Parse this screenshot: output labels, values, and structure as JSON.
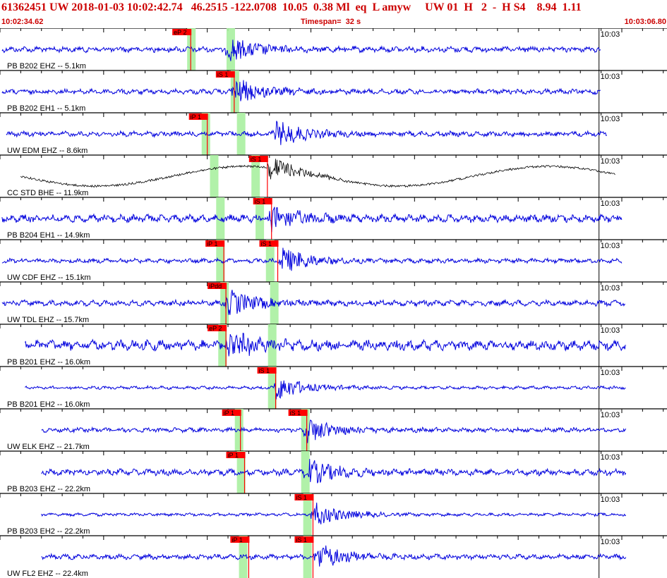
{
  "header": {
    "title": "61362451 UW 2018-01-03 10:02:42.74   46.2515 -122.0708  10.05  0.38 Ml  eq  L amyw     UW 01  H   2  -  H S4    8.94  1.11",
    "start_time": "10:02:34.62",
    "timespan": "Timespan=  32 s",
    "end_time": "10:03:06.80"
  },
  "colors": {
    "trace": "#0000dd",
    "trace_alt": "#000000",
    "pick_box": "#ff0000",
    "pick_line": "#ff0000",
    "window": "#a8f0a0",
    "header_text": "#cc0000"
  },
  "minute_label": "10:03",
  "time_axis": {
    "start_s": 0,
    "end_s": 32.18,
    "minute_mark_s": 28.9
  },
  "traces": [
    {
      "label": "PB B202 EHZ -- 5.1km",
      "color": "trace",
      "amp": 0.9,
      "start_s": 0.1,
      "end_s": 29.0,
      "burst_s": 11.0,
      "picks": [
        {
          "text": "eP 2",
          "t_s": 9.2
        }
      ],
      "windows_s": [
        9.2,
        11.1
      ]
    },
    {
      "label": "PB B202 EH1 -- 5.1km",
      "color": "trace",
      "amp": 0.8,
      "start_s": 0.1,
      "end_s": 29.0,
      "burst_s": 11.3,
      "picks": [
        {
          "text": "iS 1",
          "t_s": 11.3
        }
      ],
      "windows_s": [
        11.3
      ]
    },
    {
      "label": "UW EDM EHZ -- 8.6km",
      "color": "trace",
      "amp": 0.8,
      "start_s": 0.3,
      "end_s": 29.3,
      "burst_s": 13.3,
      "picks": [
        {
          "text": "iP 1",
          "t_s": 10.0
        }
      ],
      "windows_s": [
        9.9,
        11.6
      ]
    },
    {
      "label": "CC STD BHE -- 11.9km",
      "color": "trace_alt",
      "amp": 1.4,
      "start_s": 1.0,
      "end_s": 29.7,
      "burst_s": 12.9,
      "picks": [
        {
          "text": "iS 1",
          "t_s": 12.9
        }
      ],
      "windows_s": [
        10.3,
        12.3
      ]
    },
    {
      "label": "PB B204 EH1 -- 14.9km",
      "color": "trace",
      "amp": 1.2,
      "start_s": 0.1,
      "end_s": 30.0,
      "burst_s": 13.1,
      "picks": [
        {
          "text": "iS 1",
          "t_s": 13.1
        }
      ],
      "windows_s": [
        10.6,
        12.5
      ]
    },
    {
      "label": "UW CDF EHZ -- 15.1km",
      "color": "trace",
      "amp": 0.7,
      "start_s": 0.1,
      "end_s": 30.0,
      "burst_s": 13.6,
      "picks": [
        {
          "text": "iP 1",
          "t_s": 10.8
        },
        {
          "text": "iS 1",
          "t_s": 13.4
        }
      ],
      "windows_s": [
        10.6,
        13.0
      ]
    },
    {
      "label": "UW TDL EHZ -- 15.7km",
      "color": "trace",
      "amp": 0.9,
      "start_s": 0.1,
      "end_s": 30.2,
      "burst_s": 11.0,
      "picks": [
        {
          "text": "iPdd",
          "t_s": 10.9
        }
      ],
      "windows_s": [
        10.8,
        13.2
      ]
    },
    {
      "label": "PB B201 EHZ -- 16.0km",
      "color": "trace",
      "amp": 1.6,
      "start_s": 1.2,
      "end_s": 30.2,
      "burst_s": 11.0,
      "picks": [
        {
          "text": "eP 2",
          "t_s": 10.9
        }
      ],
      "windows_s": [
        10.7,
        13.1
      ]
    },
    {
      "label": "PB B201 EH2 -- 16.0km",
      "color": "trace",
      "amp": 0.5,
      "start_s": 1.2,
      "end_s": 30.2,
      "burst_s": 13.3,
      "picks": [
        {
          "text": "iS 1",
          "t_s": 13.3
        }
      ],
      "windows_s": [
        13.1
      ]
    },
    {
      "label": "UW ELK EHZ -- 21.7km",
      "color": "trace",
      "amp": 0.7,
      "start_s": 2.0,
      "end_s": 30.2,
      "burst_s": 14.8,
      "picks": [
        {
          "text": "iP 1",
          "t_s": 11.6
        },
        {
          "text": "iS 1",
          "t_s": 14.8
        }
      ],
      "windows_s": [
        11.5,
        14.7
      ]
    },
    {
      "label": "PB B203 EHZ -- 22.2km",
      "color": "trace",
      "amp": 1.0,
      "start_s": 2.0,
      "end_s": 30.2,
      "burst_s": 14.8,
      "picks": [
        {
          "text": "iP 1",
          "t_s": 11.8
        }
      ],
      "windows_s": [
        11.6,
        14.7
      ]
    },
    {
      "label": "PB B203 EH2 -- 22.2km",
      "color": "trace",
      "amp": 0.5,
      "start_s": 2.0,
      "end_s": 30.2,
      "burst_s": 15.1,
      "picks": [
        {
          "text": "iS 1",
          "t_s": 15.1
        }
      ],
      "windows_s": [
        14.8
      ]
    },
    {
      "label": "UW FL2 EHZ -- 22.4km",
      "color": "trace",
      "amp": 0.8,
      "start_s": 2.0,
      "end_s": 30.2,
      "burst_s": 15.3,
      "picks": [
        {
          "text": "iP 1",
          "t_s": 12.0
        },
        {
          "text": "iS 1",
          "t_s": 15.1
        }
      ],
      "windows_s": [
        11.7,
        14.8
      ]
    }
  ]
}
